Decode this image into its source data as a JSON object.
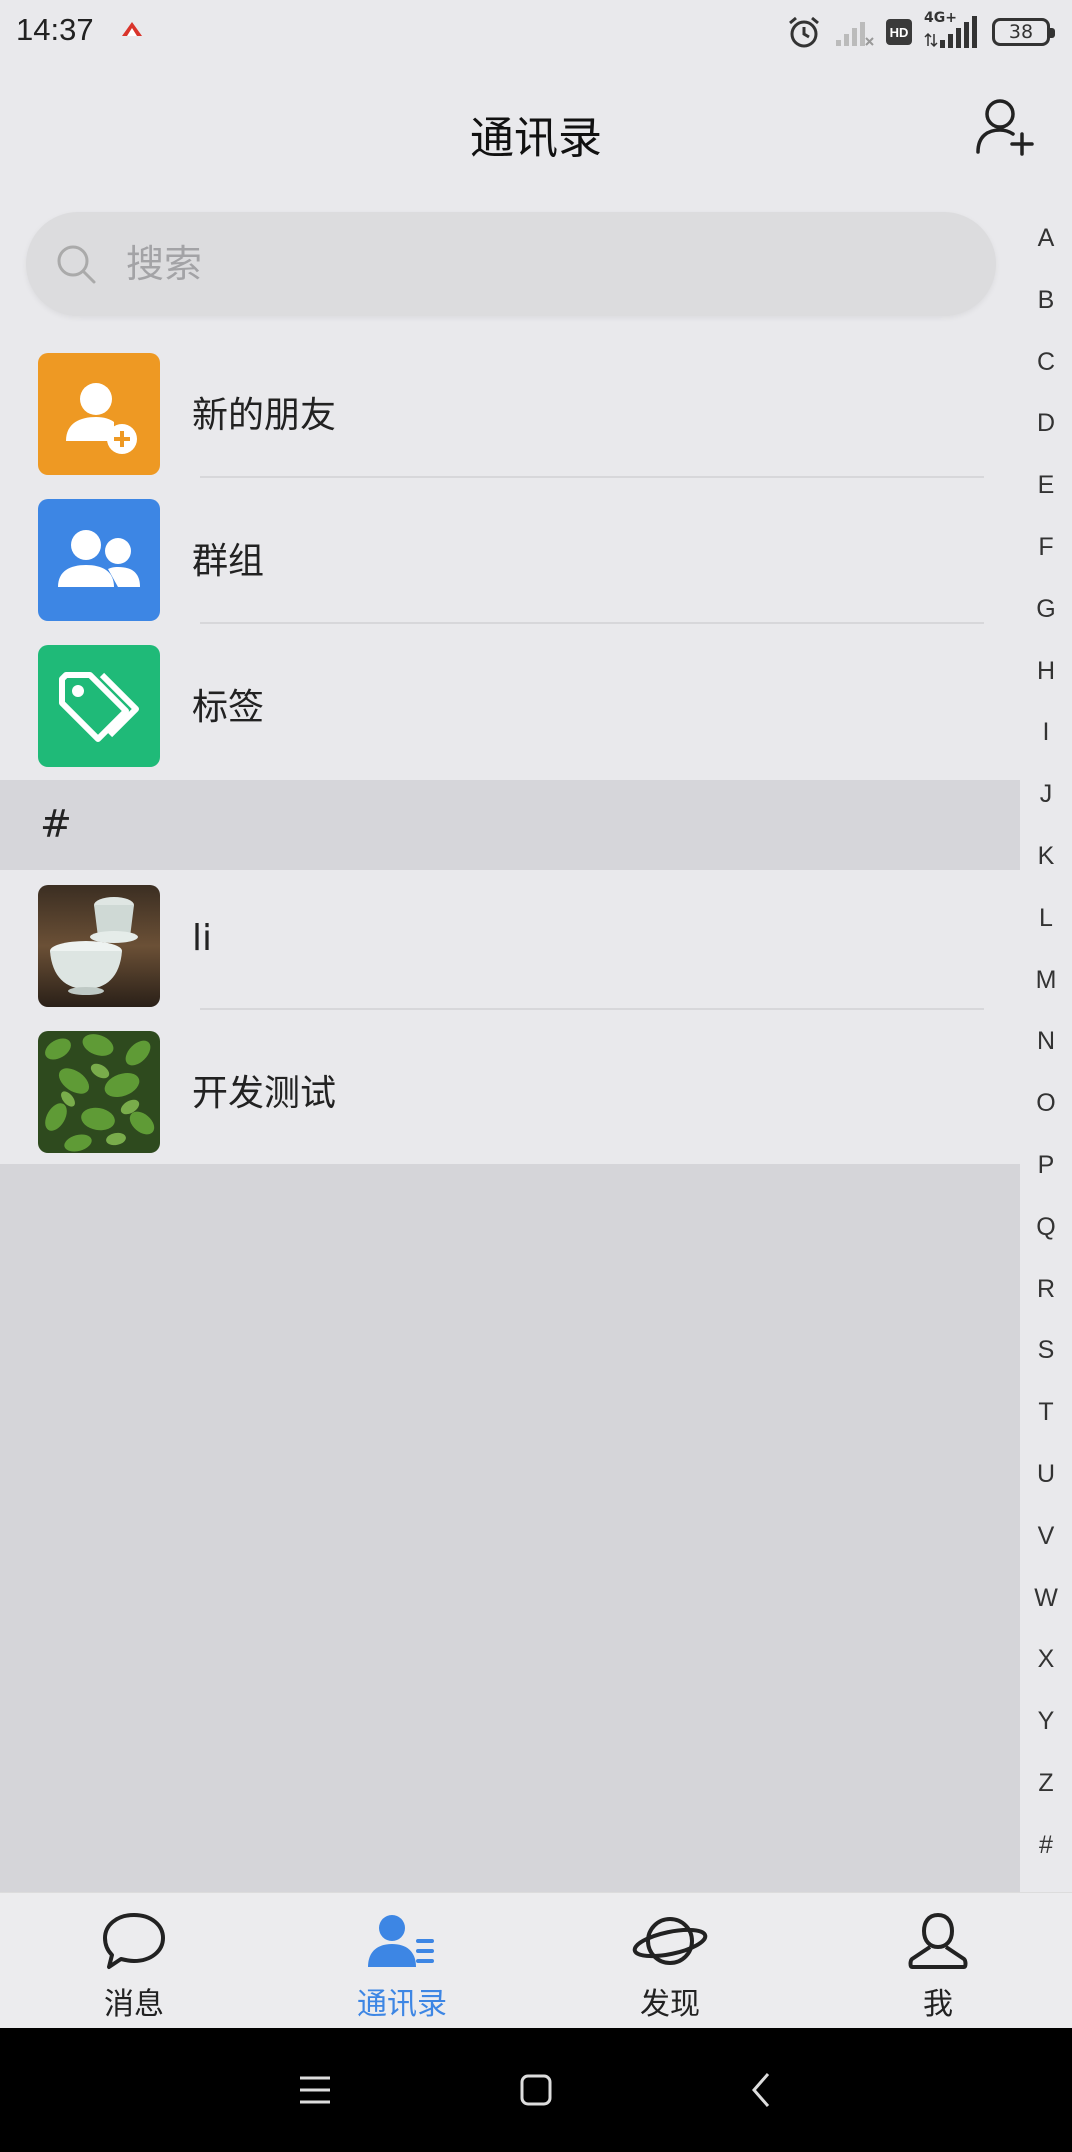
{
  "status_bar": {
    "time": "14:37",
    "battery": "38",
    "network": "4G+",
    "hd": "HD"
  },
  "header": {
    "title": "通讯录"
  },
  "search": {
    "placeholder": "搜索"
  },
  "function_items": [
    {
      "label": "新的朋友",
      "icon": "add-person-icon",
      "color": "#ee9923"
    },
    {
      "label": "群组",
      "icon": "group-icon",
      "color": "#3d86e4"
    },
    {
      "label": "标签",
      "icon": "tag-icon",
      "color": "#1fba78"
    }
  ],
  "section": {
    "header": "#"
  },
  "contacts": [
    {
      "name": "li",
      "avatar": "tea-cups-photo"
    },
    {
      "name": "开发测试",
      "avatar": "green-leaves-photo"
    }
  ],
  "alphabet": [
    "A",
    "B",
    "C",
    "D",
    "E",
    "F",
    "G",
    "H",
    "I",
    "J",
    "K",
    "L",
    "M",
    "N",
    "O",
    "P",
    "Q",
    "R",
    "S",
    "T",
    "U",
    "V",
    "W",
    "X",
    "Y",
    "Z",
    "#"
  ],
  "bottom_nav": {
    "active": 1,
    "active_color": "#3d86e4",
    "tabs": [
      {
        "label": "消息",
        "icon": "chat-bubble-icon"
      },
      {
        "label": "通讯录",
        "icon": "contacts-icon"
      },
      {
        "label": "发现",
        "icon": "planet-icon"
      },
      {
        "label": "我",
        "icon": "person-icon"
      }
    ]
  }
}
